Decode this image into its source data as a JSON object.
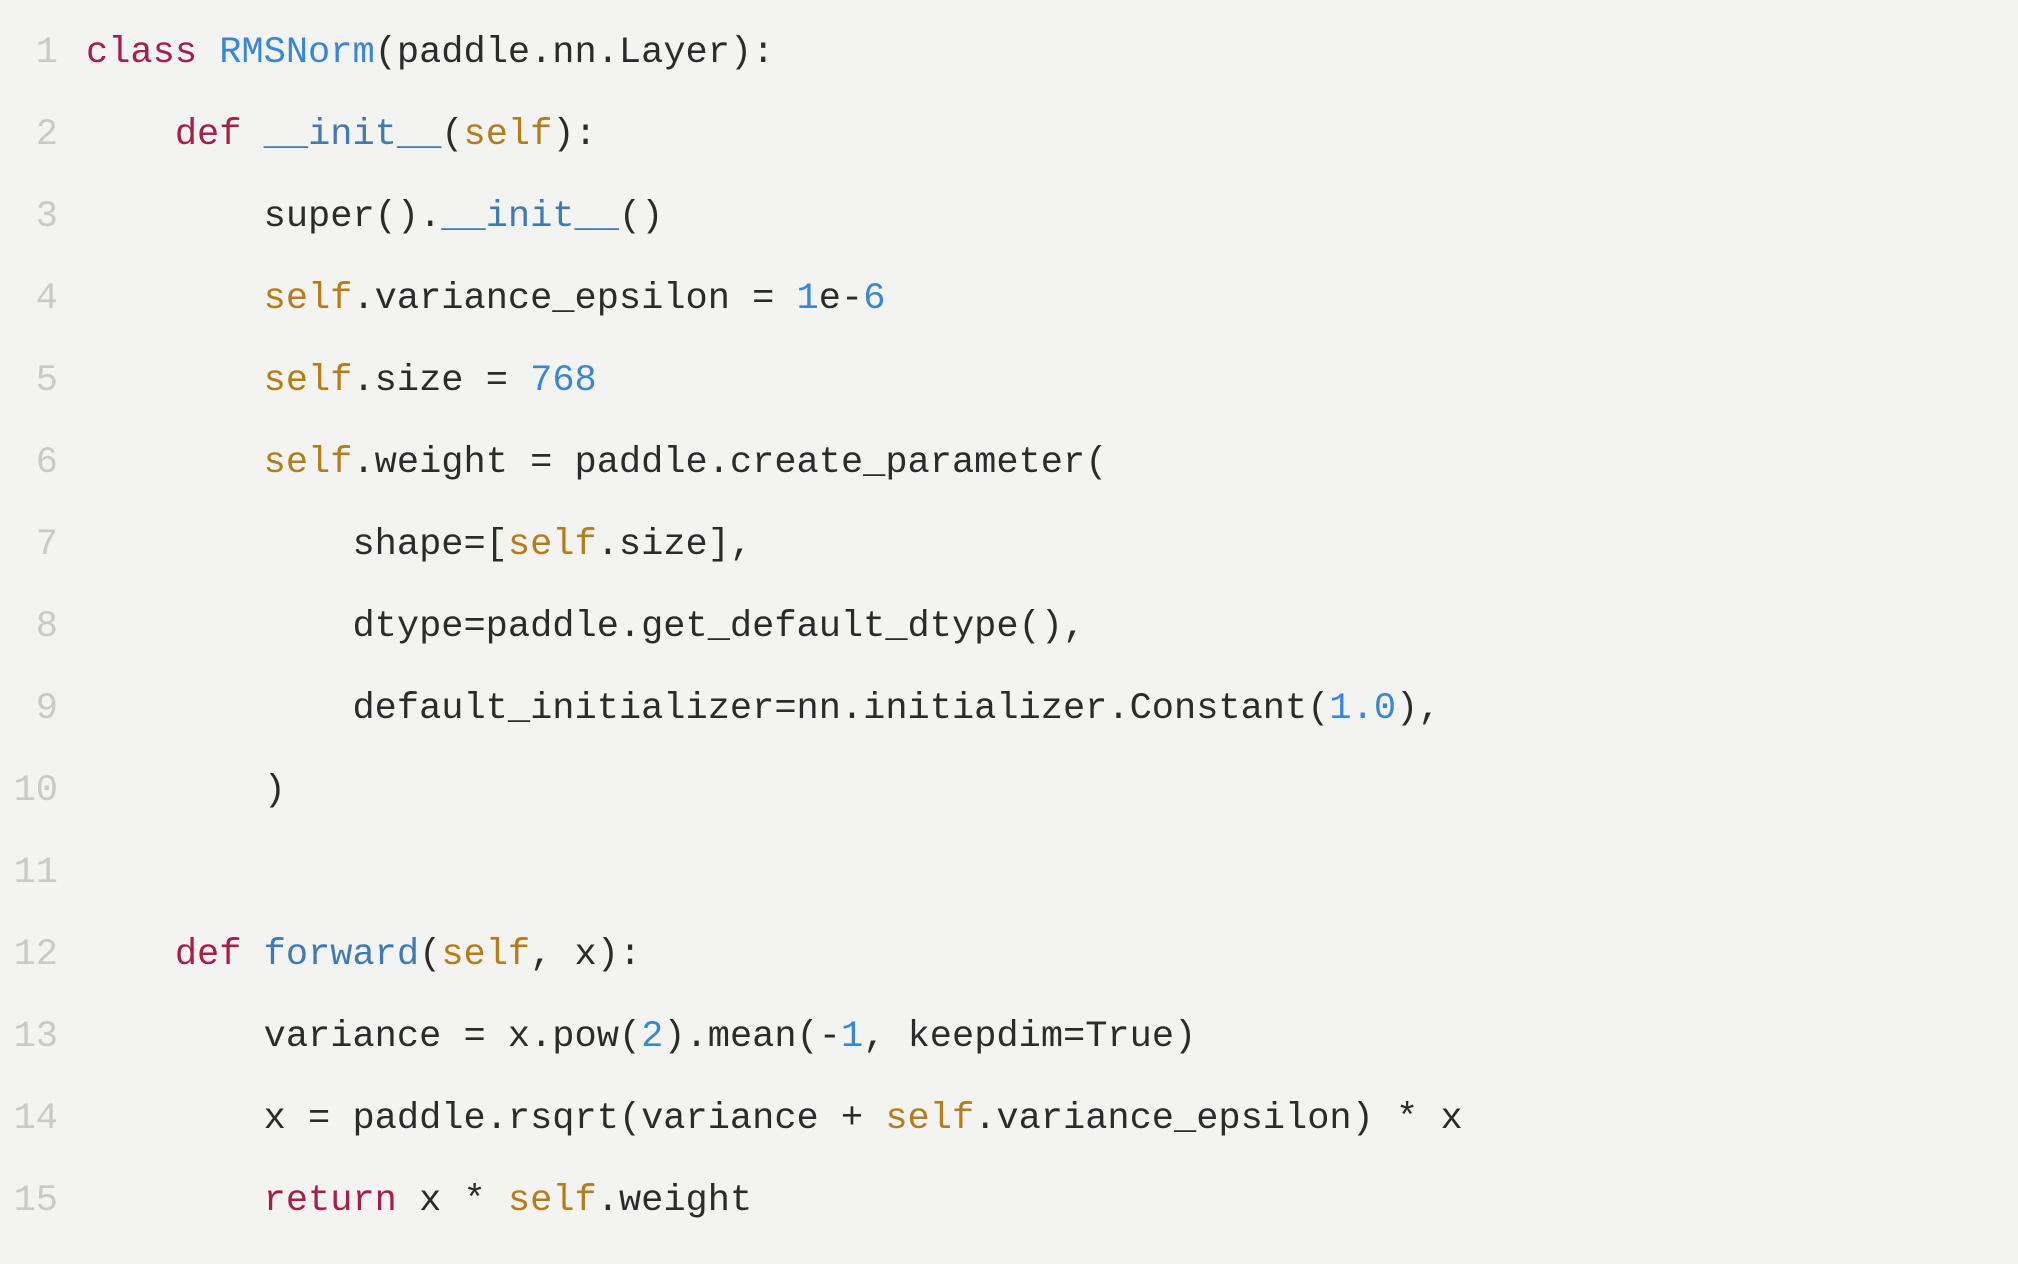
{
  "code": {
    "lines": [
      {
        "n": "1",
        "indent": "",
        "tokens": [
          {
            "t": "class ",
            "c": "kw"
          },
          {
            "t": "RMSNorm",
            "c": "cls"
          },
          {
            "t": "(paddle.nn.Layer):",
            "c": "plain"
          }
        ]
      },
      {
        "n": "2",
        "indent": "    ",
        "tokens": [
          {
            "t": "def ",
            "c": "kw"
          },
          {
            "t": "__init__",
            "c": "fn"
          },
          {
            "t": "(",
            "c": "plain"
          },
          {
            "t": "self",
            "c": "self"
          },
          {
            "t": "):",
            "c": "plain"
          }
        ]
      },
      {
        "n": "3",
        "indent": "        ",
        "tokens": [
          {
            "t": "super().",
            "c": "plain"
          },
          {
            "t": "__init__",
            "c": "fn"
          },
          {
            "t": "()",
            "c": "plain"
          }
        ]
      },
      {
        "n": "4",
        "indent": "        ",
        "tokens": [
          {
            "t": "self",
            "c": "self"
          },
          {
            "t": ".variance_epsilon = ",
            "c": "plain"
          },
          {
            "t": "1",
            "c": "num"
          },
          {
            "t": "e-",
            "c": "plain"
          },
          {
            "t": "6",
            "c": "num"
          }
        ]
      },
      {
        "n": "5",
        "indent": "        ",
        "tokens": [
          {
            "t": "self",
            "c": "self"
          },
          {
            "t": ".size = ",
            "c": "plain"
          },
          {
            "t": "768",
            "c": "num"
          }
        ]
      },
      {
        "n": "6",
        "indent": "        ",
        "tokens": [
          {
            "t": "self",
            "c": "self"
          },
          {
            "t": ".weight = paddle.create_parameter(",
            "c": "plain"
          }
        ]
      },
      {
        "n": "7",
        "indent": "            ",
        "tokens": [
          {
            "t": "shape=[",
            "c": "plain"
          },
          {
            "t": "self",
            "c": "self"
          },
          {
            "t": ".size],",
            "c": "plain"
          }
        ]
      },
      {
        "n": "8",
        "indent": "            ",
        "tokens": [
          {
            "t": "dtype=paddle.get_default_dtype(),",
            "c": "plain"
          }
        ]
      },
      {
        "n": "9",
        "indent": "            ",
        "tokens": [
          {
            "t": "default_initializer=nn.initializer.Constant(",
            "c": "plain"
          },
          {
            "t": "1.0",
            "c": "num"
          },
          {
            "t": "),",
            "c": "plain"
          }
        ]
      },
      {
        "n": "10",
        "indent": "        ",
        "tokens": [
          {
            "t": ")",
            "c": "plain"
          }
        ]
      },
      {
        "n": "11",
        "indent": "",
        "tokens": []
      },
      {
        "n": "12",
        "indent": "    ",
        "tokens": [
          {
            "t": "def ",
            "c": "kw"
          },
          {
            "t": "forward",
            "c": "fn"
          },
          {
            "t": "(",
            "c": "plain"
          },
          {
            "t": "self",
            "c": "self"
          },
          {
            "t": ", x):",
            "c": "plain"
          }
        ]
      },
      {
        "n": "13",
        "indent": "        ",
        "tokens": [
          {
            "t": "variance = x.pow(",
            "c": "plain"
          },
          {
            "t": "2",
            "c": "num"
          },
          {
            "t": ").mean(-",
            "c": "plain"
          },
          {
            "t": "1",
            "c": "num"
          },
          {
            "t": ", keepdim=True)",
            "c": "plain"
          }
        ]
      },
      {
        "n": "14",
        "indent": "        ",
        "tokens": [
          {
            "t": "x = paddle.rsqrt(variance + ",
            "c": "plain"
          },
          {
            "t": "self",
            "c": "self"
          },
          {
            "t": ".variance_epsilon) * x",
            "c": "plain"
          }
        ]
      },
      {
        "n": "15",
        "indent": "        ",
        "tokens": [
          {
            "t": "return",
            "c": "kw"
          },
          {
            "t": " x * ",
            "c": "plain"
          },
          {
            "t": "self",
            "c": "self"
          },
          {
            "t": ".weight",
            "c": "plain"
          }
        ]
      }
    ]
  }
}
